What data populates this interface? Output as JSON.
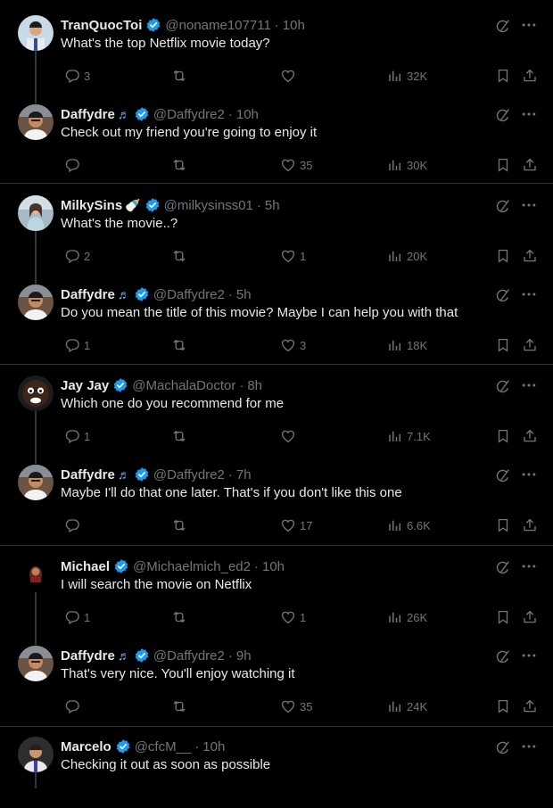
{
  "tweets": [
    {
      "name": "TranQuocToi",
      "emoji": "",
      "handle": "@noname107711",
      "time": "10h",
      "text": "What's the top Netflix movie today?",
      "replies": "3",
      "retweets": "",
      "likes": "",
      "views": "32K",
      "avatar": "a1"
    },
    {
      "name": "Daffydre",
      "emoji": "♬",
      "handle": "@Daffydre2",
      "time": "10h",
      "text": "Check out my friend you're going to enjoy it",
      "replies": "",
      "retweets": "",
      "likes": "35",
      "views": "30K",
      "avatar": "daffy"
    },
    {
      "name": "MilkySins",
      "emoji": "🍼",
      "handle": "@milkysinss01",
      "time": "5h",
      "text": "What's the movie..?",
      "replies": "2",
      "retweets": "",
      "likes": "1",
      "views": "20K",
      "avatar": "milky"
    },
    {
      "name": "Daffydre",
      "emoji": "♬",
      "handle": "@Daffydre2",
      "time": "5h",
      "text": "Do you mean the title of this movie? Maybe I can help you with that",
      "replies": "1",
      "retweets": "",
      "likes": "3",
      "views": "18K",
      "avatar": "daffy"
    },
    {
      "name": "Jay Jay",
      "emoji": "",
      "handle": "@MachalaDoctor",
      "time": "8h",
      "text": "Which one do you recommend for me",
      "replies": "1",
      "retweets": "",
      "likes": "",
      "views": "7.1K",
      "avatar": "jay"
    },
    {
      "name": "Daffydre",
      "emoji": "♬",
      "handle": "@Daffydre2",
      "time": "7h",
      "text": "Maybe I'll do that one later. That's if you don't like this one",
      "replies": "",
      "retweets": "",
      "likes": "17",
      "views": "6.6K",
      "avatar": "daffy"
    },
    {
      "name": "Michael",
      "emoji": "",
      "handle": "@Michaelmich_ed2",
      "time": "10h",
      "text": "I will search the movie on Netflix",
      "replies": "1",
      "retweets": "",
      "likes": "1",
      "views": "26K",
      "avatar": "michael"
    },
    {
      "name": "Daffydre",
      "emoji": "♬",
      "handle": "@Daffydre2",
      "time": "9h",
      "text": "That's very nice. You'll enjoy watching it",
      "replies": "",
      "retweets": "",
      "likes": "35",
      "views": "24K",
      "avatar": "daffy"
    },
    {
      "name": "Marcelo",
      "emoji": "",
      "handle": "@cfcM__",
      "time": "10h",
      "text": "Checking it out as soon as possible",
      "replies": "",
      "retweets": "",
      "likes": "",
      "views": "",
      "avatar": "marcelo"
    }
  ],
  "separator": "·",
  "colors": {
    "background": "#000000",
    "text": "#e7e9ea",
    "muted": "#71767b",
    "verified": "#1d9bf0",
    "divider": "#2f3336"
  },
  "icons": {
    "reply": "reply-icon",
    "retweet": "retweet-icon",
    "like": "like-icon",
    "views": "views-icon",
    "bookmark": "bookmark-icon",
    "share": "share-icon",
    "grok": "grok-icon",
    "more": "more-icon",
    "verified": "verified-badge-icon"
  }
}
